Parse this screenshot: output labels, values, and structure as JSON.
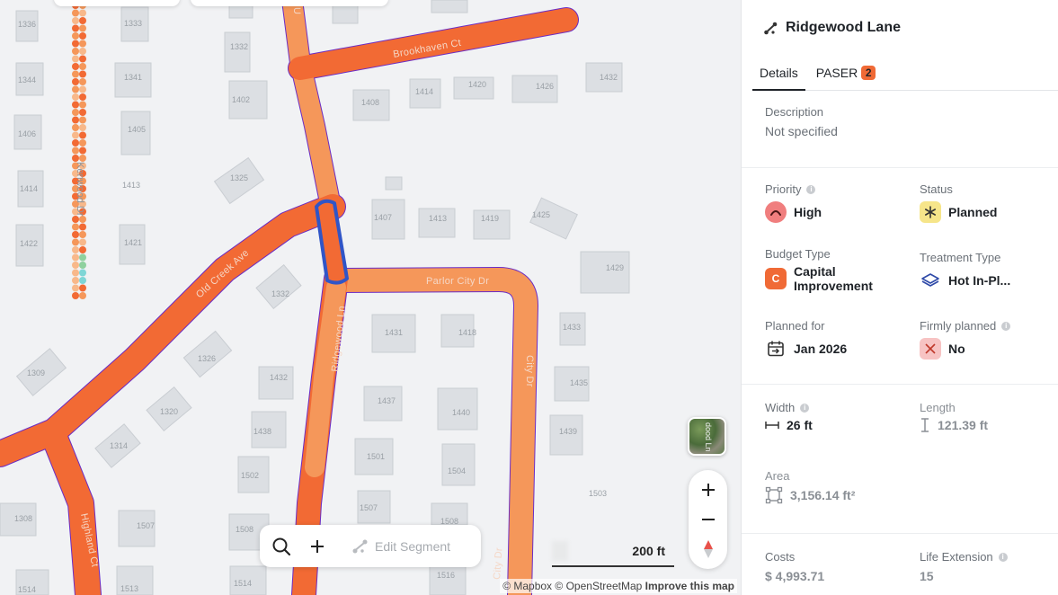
{
  "map": {
    "house_numbers": [
      "1336",
      "1333",
      "1344",
      "1341",
      "1332",
      "1402",
      "1406",
      "1405",
      "1414",
      "1413",
      "1422",
      "1421",
      "1325",
      "1332",
      "1309",
      "1326",
      "1320",
      "1314",
      "1308",
      "1507",
      "1513",
      "1514",
      "1408",
      "1414",
      "1420",
      "1426",
      "1432",
      "1407",
      "1413",
      "1419",
      "1425",
      "1429",
      "1431",
      "1418",
      "1433",
      "1432",
      "1437",
      "1440",
      "1435",
      "1438",
      "1439",
      "1502",
      "1501",
      "1504",
      "1503",
      "1508",
      "1507",
      "1508",
      "1514",
      "1516"
    ],
    "streets": {
      "brookhaven": "Brookhaven Ct",
      "kenwood": "Kenwood Dr",
      "old_creek": "Old Creek Ave",
      "parlor_city": "Parlor City Dr",
      "ridgewood": "Ridgewood Ln",
      "highland": "Highland Ct",
      "city_dr_lower": "City Dr",
      "city_dr_right": "City Dr",
      "top_u": "U",
      "sat_thumb_label": "dood Ln"
    },
    "toolbar": {
      "edit_segment": "Edit Segment"
    },
    "scale_label": "200 ft",
    "attribution": {
      "mapbox": "© Mapbox",
      "osm": "© OpenStreetMap",
      "improve": "Improve this map"
    },
    "colors": {
      "road_high": "#f26a34",
      "road_medium": "#f5975a",
      "selection_outline": "#3055c7",
      "road_edge": "#6b2cc4"
    }
  },
  "panel": {
    "title": "Ridgewood Lane",
    "tabs": [
      {
        "label": "Details",
        "active": true
      },
      {
        "label": "PASER",
        "badge": "2"
      }
    ],
    "description": {
      "label": "Description",
      "value": "Not specified"
    },
    "priority": {
      "label": "Priority",
      "value": "High",
      "color": "#f07e7e"
    },
    "status": {
      "label": "Status",
      "value": "Planned",
      "color": "#f6e58a"
    },
    "budget_type": {
      "label": "Budget Type",
      "value_line1": "Capital",
      "value_line2": "Improvement",
      "icon_letter": "C",
      "color": "#f06a36"
    },
    "treatment_type": {
      "label": "Treatment Type",
      "value": "Hot In-Pl..."
    },
    "planned_for": {
      "label": "Planned for",
      "value": "Jan 2026"
    },
    "firmly_planned": {
      "label": "Firmly planned",
      "value": "No",
      "color": "#f7c3c3"
    },
    "width": {
      "label": "Width",
      "value": "26 ft"
    },
    "length": {
      "label": "Length",
      "value": "121.39 ft"
    },
    "area": {
      "label": "Area",
      "value": "3,156.14 ft²"
    },
    "costs": {
      "label": "Costs",
      "value": "$ 4,993.71"
    },
    "life_extension": {
      "label": "Life Extension",
      "value": "15"
    }
  }
}
